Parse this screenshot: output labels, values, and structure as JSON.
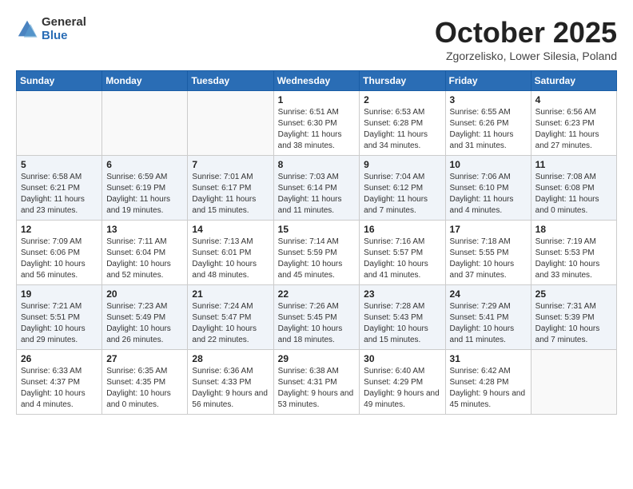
{
  "header": {
    "logo": {
      "general": "General",
      "blue": "Blue"
    },
    "title": "October 2025",
    "location": "Zgorzelisko, Lower Silesia, Poland"
  },
  "weekdays": [
    "Sunday",
    "Monday",
    "Tuesday",
    "Wednesday",
    "Thursday",
    "Friday",
    "Saturday"
  ],
  "weeks": [
    [
      {
        "day": "",
        "info": ""
      },
      {
        "day": "",
        "info": ""
      },
      {
        "day": "",
        "info": ""
      },
      {
        "day": "1",
        "info": "Sunrise: 6:51 AM\nSunset: 6:30 PM\nDaylight: 11 hours\nand 38 minutes."
      },
      {
        "day": "2",
        "info": "Sunrise: 6:53 AM\nSunset: 6:28 PM\nDaylight: 11 hours\nand 34 minutes."
      },
      {
        "day": "3",
        "info": "Sunrise: 6:55 AM\nSunset: 6:26 PM\nDaylight: 11 hours\nand 31 minutes."
      },
      {
        "day": "4",
        "info": "Sunrise: 6:56 AM\nSunset: 6:23 PM\nDaylight: 11 hours\nand 27 minutes."
      }
    ],
    [
      {
        "day": "5",
        "info": "Sunrise: 6:58 AM\nSunset: 6:21 PM\nDaylight: 11 hours\nand 23 minutes."
      },
      {
        "day": "6",
        "info": "Sunrise: 6:59 AM\nSunset: 6:19 PM\nDaylight: 11 hours\nand 19 minutes."
      },
      {
        "day": "7",
        "info": "Sunrise: 7:01 AM\nSunset: 6:17 PM\nDaylight: 11 hours\nand 15 minutes."
      },
      {
        "day": "8",
        "info": "Sunrise: 7:03 AM\nSunset: 6:14 PM\nDaylight: 11 hours\nand 11 minutes."
      },
      {
        "day": "9",
        "info": "Sunrise: 7:04 AM\nSunset: 6:12 PM\nDaylight: 11 hours\nand 7 minutes."
      },
      {
        "day": "10",
        "info": "Sunrise: 7:06 AM\nSunset: 6:10 PM\nDaylight: 11 hours\nand 4 minutes."
      },
      {
        "day": "11",
        "info": "Sunrise: 7:08 AM\nSunset: 6:08 PM\nDaylight: 11 hours\nand 0 minutes."
      }
    ],
    [
      {
        "day": "12",
        "info": "Sunrise: 7:09 AM\nSunset: 6:06 PM\nDaylight: 10 hours\nand 56 minutes."
      },
      {
        "day": "13",
        "info": "Sunrise: 7:11 AM\nSunset: 6:04 PM\nDaylight: 10 hours\nand 52 minutes."
      },
      {
        "day": "14",
        "info": "Sunrise: 7:13 AM\nSunset: 6:01 PM\nDaylight: 10 hours\nand 48 minutes."
      },
      {
        "day": "15",
        "info": "Sunrise: 7:14 AM\nSunset: 5:59 PM\nDaylight: 10 hours\nand 45 minutes."
      },
      {
        "day": "16",
        "info": "Sunrise: 7:16 AM\nSunset: 5:57 PM\nDaylight: 10 hours\nand 41 minutes."
      },
      {
        "day": "17",
        "info": "Sunrise: 7:18 AM\nSunset: 5:55 PM\nDaylight: 10 hours\nand 37 minutes."
      },
      {
        "day": "18",
        "info": "Sunrise: 7:19 AM\nSunset: 5:53 PM\nDaylight: 10 hours\nand 33 minutes."
      }
    ],
    [
      {
        "day": "19",
        "info": "Sunrise: 7:21 AM\nSunset: 5:51 PM\nDaylight: 10 hours\nand 29 minutes."
      },
      {
        "day": "20",
        "info": "Sunrise: 7:23 AM\nSunset: 5:49 PM\nDaylight: 10 hours\nand 26 minutes."
      },
      {
        "day": "21",
        "info": "Sunrise: 7:24 AM\nSunset: 5:47 PM\nDaylight: 10 hours\nand 22 minutes."
      },
      {
        "day": "22",
        "info": "Sunrise: 7:26 AM\nSunset: 5:45 PM\nDaylight: 10 hours\nand 18 minutes."
      },
      {
        "day": "23",
        "info": "Sunrise: 7:28 AM\nSunset: 5:43 PM\nDaylight: 10 hours\nand 15 minutes."
      },
      {
        "day": "24",
        "info": "Sunrise: 7:29 AM\nSunset: 5:41 PM\nDaylight: 10 hours\nand 11 minutes."
      },
      {
        "day": "25",
        "info": "Sunrise: 7:31 AM\nSunset: 5:39 PM\nDaylight: 10 hours\nand 7 minutes."
      }
    ],
    [
      {
        "day": "26",
        "info": "Sunrise: 6:33 AM\nSunset: 4:37 PM\nDaylight: 10 hours\nand 4 minutes."
      },
      {
        "day": "27",
        "info": "Sunrise: 6:35 AM\nSunset: 4:35 PM\nDaylight: 10 hours\nand 0 minutes."
      },
      {
        "day": "28",
        "info": "Sunrise: 6:36 AM\nSunset: 4:33 PM\nDaylight: 9 hours\nand 56 minutes."
      },
      {
        "day": "29",
        "info": "Sunrise: 6:38 AM\nSunset: 4:31 PM\nDaylight: 9 hours\nand 53 minutes."
      },
      {
        "day": "30",
        "info": "Sunrise: 6:40 AM\nSunset: 4:29 PM\nDaylight: 9 hours\nand 49 minutes."
      },
      {
        "day": "31",
        "info": "Sunrise: 6:42 AM\nSunset: 4:28 PM\nDaylight: 9 hours\nand 45 minutes."
      },
      {
        "day": "",
        "info": ""
      }
    ]
  ]
}
